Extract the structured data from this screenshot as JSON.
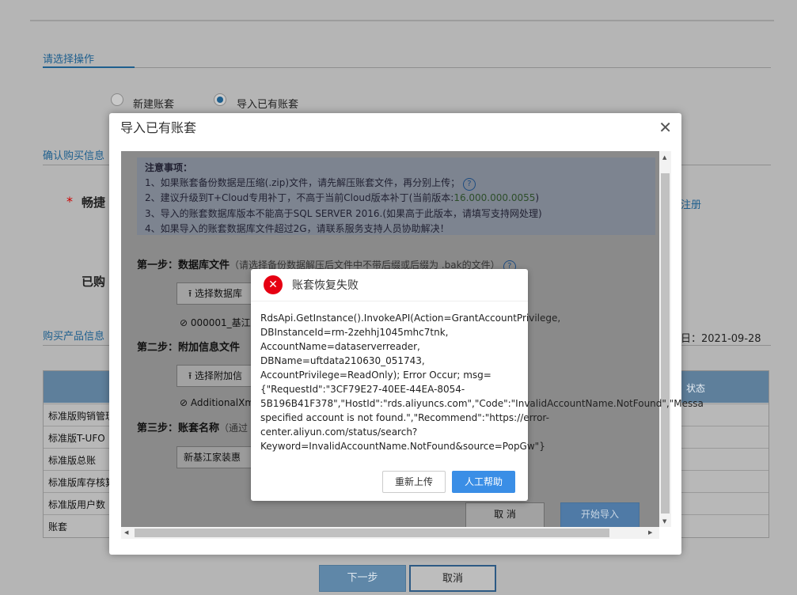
{
  "background": {
    "section1_title": "请选择操作",
    "radio_new": "新建账套",
    "radio_import": "导入已有账套",
    "section2_title": "确认购买信息",
    "product_label_partial": "畅捷",
    "register_link": "注册",
    "purchased_label_partial": "已购",
    "section3_title": "购买产品信息",
    "date_text": "日：2021-09-28",
    "table_status_header": "状态",
    "table_rows": [
      "标准版购销管理",
      "标准版T-UFO",
      "标准版总账",
      "标准版库存核算",
      "标准版用户数",
      "账套"
    ],
    "next_button": "下一步",
    "cancel_button": "取消"
  },
  "dialog": {
    "title": "导入已有账套",
    "close": "✕",
    "notice": {
      "heading": "注意事项：",
      "line1": "1、如果账套备份数据是压缩(.zip)文件，请先解压账套文件，再分别上传；",
      "line2a": "2、建议升级到T+Cloud专用补丁，不高于当前Cloud版本补丁(当前版本:",
      "line2v": "16.000.000.0055",
      "line2b": ")",
      "line3": "3、导入的账套数据库版本不能高于SQL SERVER 2016.(如果高于此版本，请填写支持网处理)",
      "line4": "4、如果导入的账套数据库文件超过2G，请联系服务支持人员协助解决！"
    },
    "step1_label": "第一步：数据库文件",
    "step1_hint": "（请选择备份数据解压后文件中不带后缀或后缀为 .bak的文件）",
    "upload_db_button": "选择数据库",
    "db_file": "000001_基江",
    "step2_label": "第二步：附加信息文件",
    "upload_attach_button": "选择附加信",
    "attach_file": "AdditionalXm",
    "step3_label": "第三步：账套名称",
    "step3_hint": "（通过",
    "account_name_value": "新基江家装惠",
    "cancel_button": "取 消",
    "start_import_button": "开始导入"
  },
  "error": {
    "title": "账套恢复失败",
    "message": "RdsApi.GetInstance().InvokeAPI(Action=GrantAccountPrivilege,\nDBInstanceId=rm-2zehhj1045mhc7tnk,\nAccountName=dataserverreader,\nDBName=uftdata210630_051743,\nAccountPrivilege=ReadOnly); Error Occur; msg=\n{\"RequestId\":\"3CF79E27-40EE-44EA-8054-\n5B196B41F378\",\"HostId\":\"rds.aliyuncs.com\",\"Code\":\"InvalidAccountName.NotFound\",\"Messa\nspecified account is not found.\",\"Recommend\":\"https://error-\ncenter.aliyun.com/status/search?\nKeyword=InvalidAccountName.NotFound&source=PopGw\"}",
    "reupload_button": "重新上传",
    "help_button": "人工帮助"
  },
  "colors": {
    "accent": "#1e5f8e",
    "primary_button": "#3a8ee6",
    "error_red": "#e60012"
  }
}
